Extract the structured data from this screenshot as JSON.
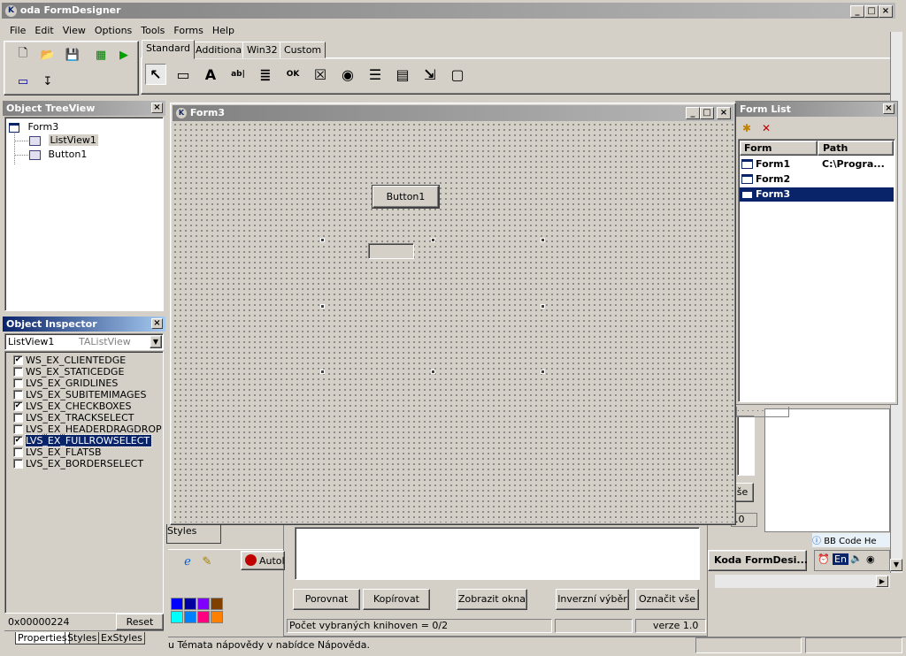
{
  "app": {
    "title": "oda FormDesigner"
  },
  "menu": [
    "File",
    "Edit",
    "View",
    "Options",
    "Tools",
    "Forms",
    "Help"
  ],
  "palette_tabs": [
    "Standard",
    "Additional",
    "Win32",
    "Custom"
  ],
  "palette_tools": [
    {
      "name": "pointer-icon",
      "glyph": "↖"
    },
    {
      "name": "groupbox-icon",
      "glyph": "▭"
    },
    {
      "name": "label-icon",
      "glyph": "A"
    },
    {
      "name": "edit-icon",
      "glyph": "ab|"
    },
    {
      "name": "memo-icon",
      "glyph": "≣"
    },
    {
      "name": "button-icon",
      "glyph": "OK"
    },
    {
      "name": "checkbox-icon",
      "glyph": "☒"
    },
    {
      "name": "radio-icon",
      "glyph": "◉"
    },
    {
      "name": "listbox-icon",
      "glyph": "☰"
    },
    {
      "name": "combobox-icon",
      "glyph": "▤"
    },
    {
      "name": "scrollbar-icon",
      "glyph": "⇲"
    },
    {
      "name": "panel-icon",
      "glyph": "▢"
    }
  ],
  "treeview": {
    "title": "Object TreeView",
    "root": "Form3",
    "children": [
      "ListView1",
      "Button1"
    ]
  },
  "inspector": {
    "title": "Object Inspector",
    "object_name": "ListView1",
    "object_type": "TAListView",
    "styles": [
      {
        "label": "WS_EX_CLIENTEDGE",
        "checked": true
      },
      {
        "label": "WS_EX_STATICEDGE",
        "checked": false
      },
      {
        "label": "LVS_EX_GRIDLINES",
        "checked": false
      },
      {
        "label": "LVS_EX_SUBITEMIMAGES",
        "checked": false
      },
      {
        "label": "LVS_EX_CHECKBOXES",
        "checked": true
      },
      {
        "label": "LVS_EX_TRACKSELECT",
        "checked": false
      },
      {
        "label": "LVS_EX_HEADERDRAGDROP",
        "checked": false
      },
      {
        "label": "LVS_EX_FULLROWSELECT",
        "checked": true,
        "selected": true
      },
      {
        "label": "LVS_EX_FLATSB",
        "checked": false
      },
      {
        "label": "LVS_EX_BORDERSELECT",
        "checked": false
      }
    ],
    "value": "0x00000224",
    "reset_label": "Reset",
    "tabs": [
      "Properties",
      "Styles",
      "ExStyles"
    ]
  },
  "form3": {
    "title": "Form3",
    "button_caption": "Button1"
  },
  "formlist": {
    "title": "Form List",
    "columns": [
      "Form",
      "Path"
    ],
    "rows": [
      {
        "form": "Form1",
        "path": "C:\\Progra..."
      },
      {
        "form": "Form2",
        "path": ""
      },
      {
        "form": "Form3",
        "path": ""
      }
    ]
  },
  "background_app": {
    "buttons": [
      "Porovnat",
      "Kopírovat",
      "Zobrazit okna",
      "Inverzní výběr",
      "Označit vše"
    ],
    "status": "Počet vybraných knihoven = 0/2",
    "version": "verze 1.0",
    "styles_tab": "Styles",
    "taskbar_autoit": "AutoI",
    "taskbar_koda": "Koda FormDesi...",
    "lang": "En",
    "bbcode": "BB Code He",
    "se_btn": "še",
    "ver_frag": ".0"
  },
  "statusbar": {
    "text": "u Témata nápovědy v nabídce Nápověda."
  },
  "colors": {
    "accent": "#0a246a",
    "swatches": [
      "#0000ff",
      "#0000a0",
      "#8000ff",
      "#804000",
      "#00ffff",
      "#0080ff",
      "#ff0080",
      "#ff8000"
    ]
  }
}
